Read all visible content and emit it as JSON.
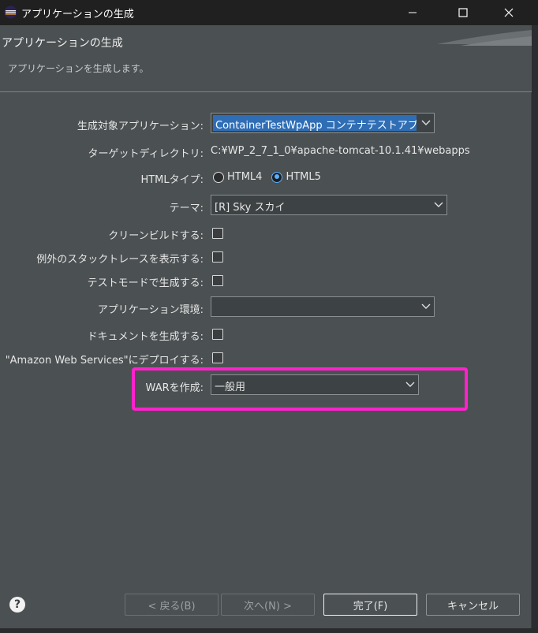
{
  "window": {
    "title": "アプリケーションの生成"
  },
  "header": {
    "title": "アプリケーションの生成",
    "description": "アプリケーションを生成します。"
  },
  "form": {
    "target_app": {
      "label": "生成対象アプリケーション:",
      "value": "ContainerTestWpApp コンテナテストアプリ"
    },
    "target_dir": {
      "label": "ターゲットディレクトリ:",
      "value": "C:¥WP_2_7_1_0¥apache-tomcat-10.1.41¥webapps"
    },
    "html_type": {
      "label": "HTMLタイプ:",
      "options": [
        "HTML4",
        "HTML5"
      ],
      "selected": "HTML5"
    },
    "theme": {
      "label": "テーマ:",
      "value": "[R] Sky スカイ"
    },
    "clean_build": {
      "label": "クリーンビルドする:",
      "checked": false
    },
    "stack_trace": {
      "label": "例外のスタックトレースを表示する:",
      "checked": false
    },
    "test_mode": {
      "label": "テストモードで生成する:",
      "checked": false
    },
    "app_env": {
      "label": "アプリケーション環境:",
      "value": ""
    },
    "gen_docs": {
      "label": "ドキュメントを生成する:",
      "checked": false
    },
    "deploy_aws": {
      "label": "\"Amazon Web Services\"にデプロイする:",
      "checked": false
    },
    "war": {
      "label": "WARを作成:",
      "value": "一般用"
    }
  },
  "footer": {
    "back_label": "< 戻る(B)",
    "next_label": "次へ(N) >",
    "finish_label": "完了(F)",
    "cancel_label": "キャンセル"
  },
  "colors": {
    "dialog_bg": "#4b5052",
    "highlight": "#ff22cc",
    "selection": "#2f6eb5"
  }
}
